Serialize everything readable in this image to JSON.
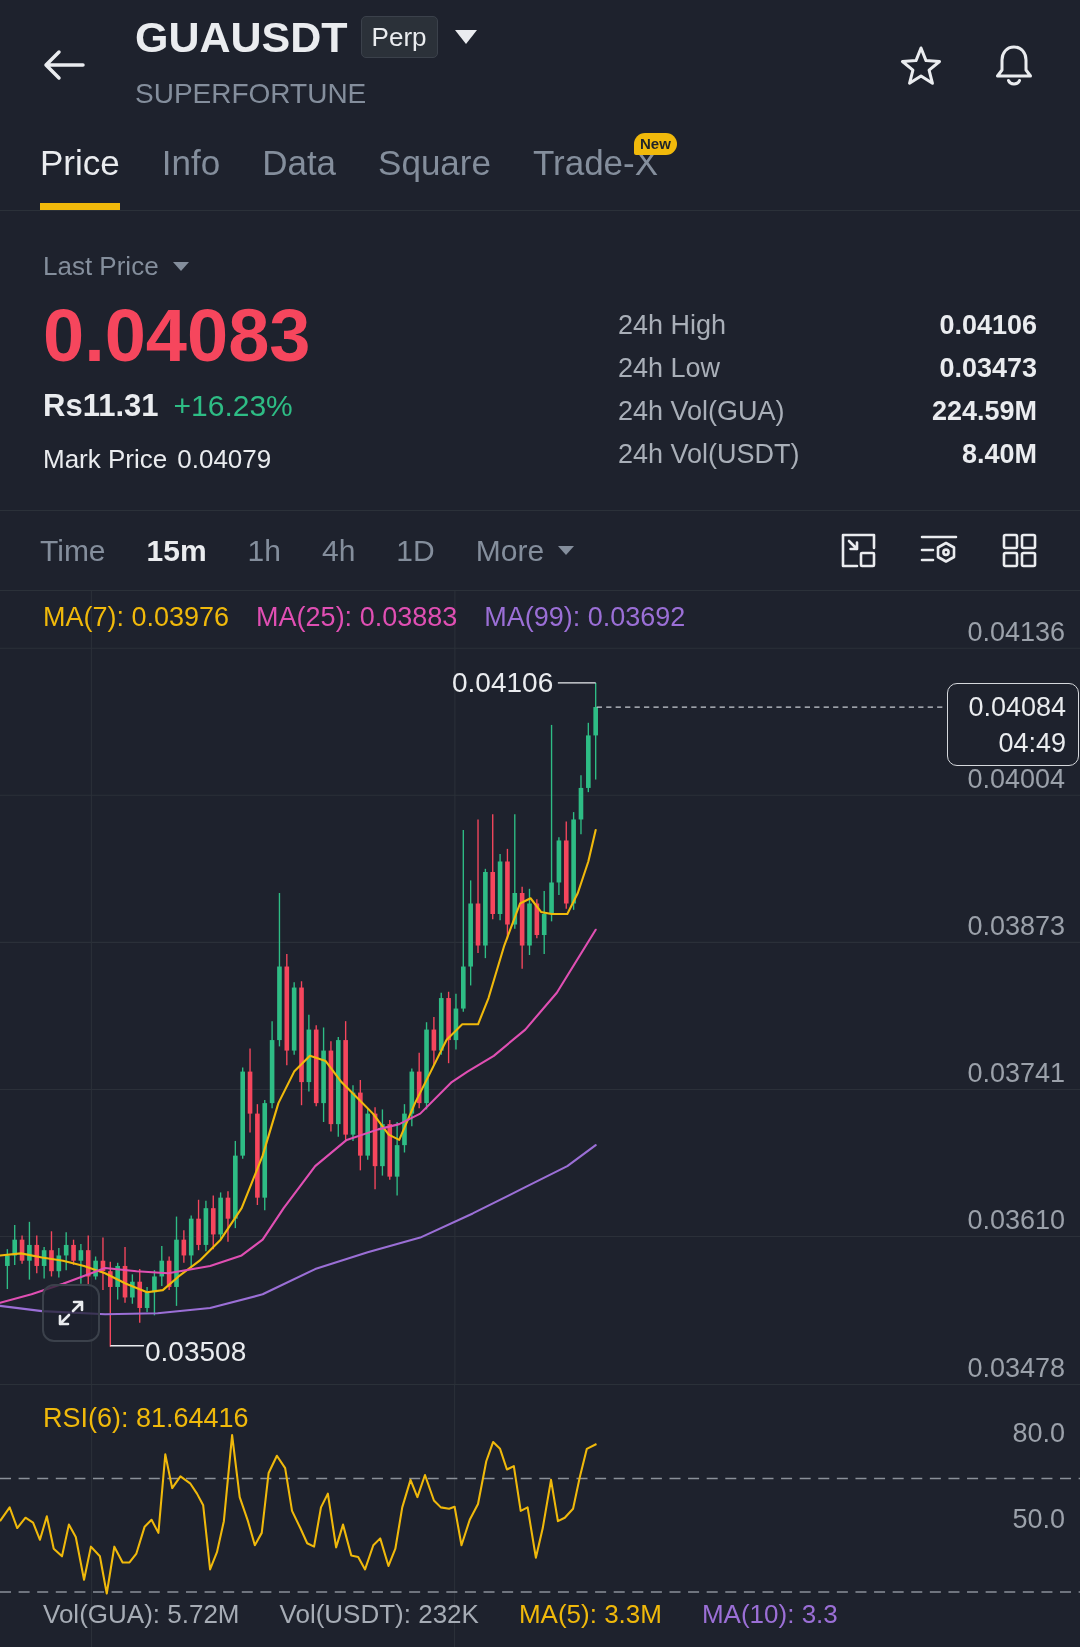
{
  "header": {
    "symbol": "GUAUSDT",
    "contract_type": "Perp",
    "subtitle": "SUPERFORTUNE"
  },
  "tabs": [
    {
      "label": "Price",
      "selected": true
    },
    {
      "label": "Info",
      "selected": false
    },
    {
      "label": "Data",
      "selected": false
    },
    {
      "label": "Square",
      "selected": false
    },
    {
      "label": "Trade-X",
      "selected": false,
      "badge": "New"
    }
  ],
  "price_summary": {
    "price_type": "Last Price",
    "last_price": "0.04083",
    "last_price_rising": false,
    "fiat_price": "Rs11.31",
    "change": "+16.23%",
    "change_rising": true,
    "mark_price_label": "Mark Price",
    "mark_price": "0.04079"
  },
  "stats": [
    {
      "label": "24h High",
      "value": "0.04106"
    },
    {
      "label": "24h Low",
      "value": "0.03473"
    },
    {
      "label": "24h Vol(GUA)",
      "value": "224.59M"
    },
    {
      "label": "24h Vol(USDT)",
      "value": "8.40M"
    }
  ],
  "intervals": [
    {
      "label": "Time",
      "kind": "interval",
      "selected": false
    },
    {
      "label": "15m",
      "kind": "interval",
      "selected": true
    },
    {
      "label": "1h",
      "kind": "interval",
      "selected": false
    },
    {
      "label": "4h",
      "kind": "interval",
      "selected": false
    },
    {
      "label": "1D",
      "kind": "interval",
      "selected": false
    },
    {
      "label": "More",
      "kind": "menu",
      "selected": false
    }
  ],
  "chart": {
    "ma_legend": [
      {
        "label": "MA(7): 0.03976",
        "color": "#f0b90b"
      },
      {
        "label": "MA(25): 0.03883",
        "color": "#e04fb3"
      },
      {
        "label": "MA(99): 0.03692",
        "color": "#9b6fd6"
      }
    ],
    "price_axis": [
      "0.04136",
      "0.04004",
      "0.03873",
      "0.03741",
      "0.03610",
      "0.03478"
    ],
    "high_label": "0.04106",
    "low_label": "0.03508",
    "current_price": "0.04084",
    "countdown": "04:49"
  },
  "rsi": {
    "legend": "RSI(6): 81.64416",
    "axis": [
      "80.0",
      "50.0"
    ]
  },
  "volume_legend": [
    {
      "label": "Vol(GUA): 5.72M",
      "color": "#a6acb5"
    },
    {
      "label": "Vol(USDT): 232K",
      "color": "#a6acb5"
    },
    {
      "label": "MA(5): 3.3M",
      "color": "#f0b90b"
    },
    {
      "label": "MA(10): 3.3",
      "color": "#9b6fd6"
    }
  ]
}
